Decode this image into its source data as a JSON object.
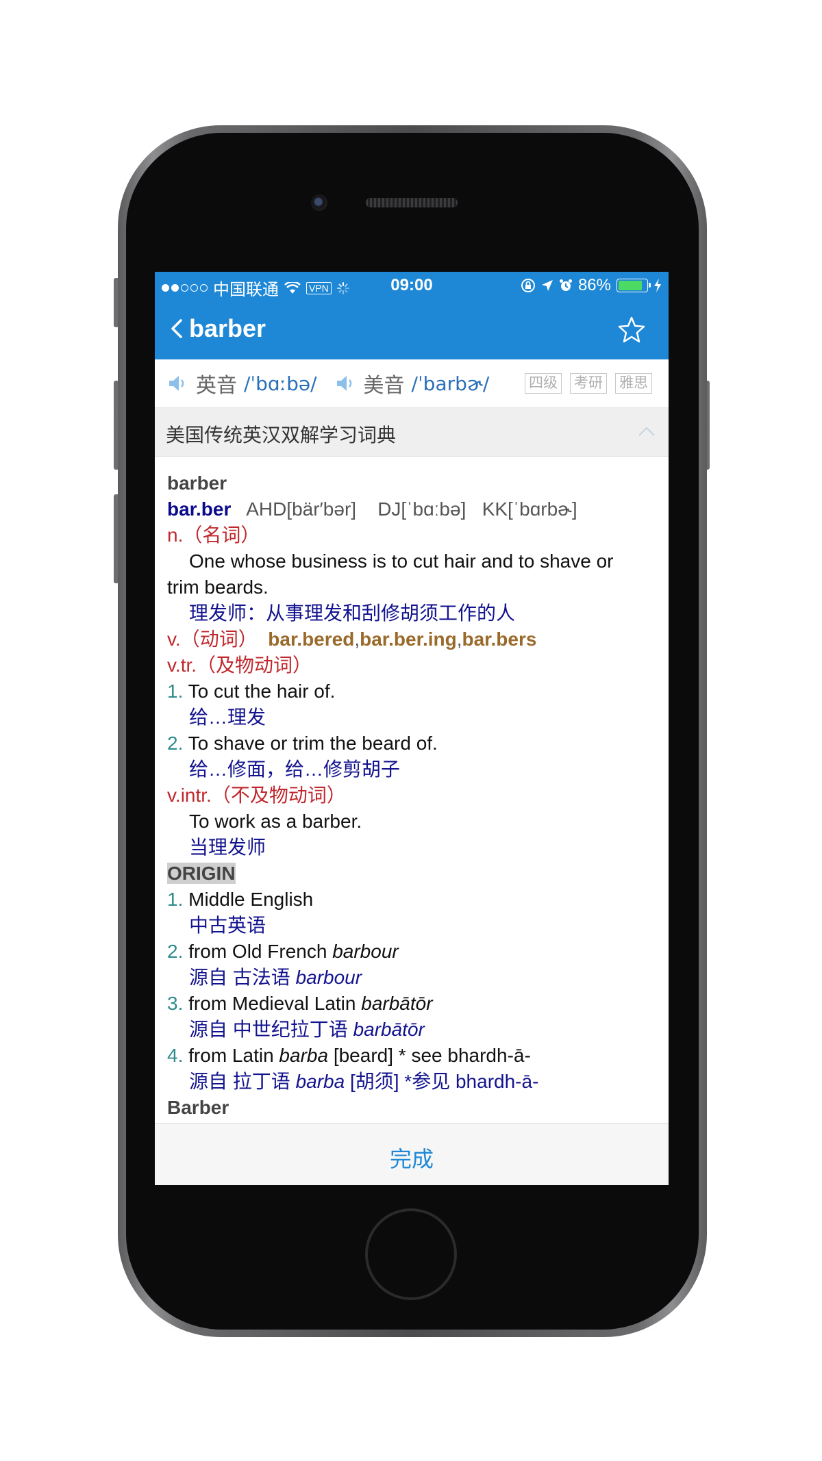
{
  "status": {
    "carrier": "中国联通",
    "vpn": "VPN",
    "time": "09:00",
    "battery": "86%",
    "battery_level": 0.86
  },
  "nav": {
    "title": "barber"
  },
  "pronunciation": {
    "uk_label": "英音",
    "uk_ipa": "/ˈbɑːbə/",
    "us_label": "美音",
    "us_ipa": "/ˈbarbɚ/",
    "tags": [
      "四级",
      "考研",
      "雅思"
    ]
  },
  "dictionary": {
    "name": "美国传统英汉双解学习词典"
  },
  "entry": {
    "headword": "barber",
    "syllabified": "bar.ber",
    "ahd": "AHD[bär′bər]",
    "dj": "DJ[ˈbɑːbə]",
    "kk": "KK[ˈbɑrbɚ]",
    "noun_label": "n.（名词）",
    "noun_def_en": "One whose business is to cut hair and to shave or",
    "noun_def_en2": "trim beards.",
    "noun_def_cn": "理发师：从事理发和刮修胡须工作的人",
    "verb_label": "v.（动词）",
    "verb_forms": [
      "bar.bered",
      "bar.ber.ing",
      "bar.bers"
    ],
    "vtr_label": "v.tr.（及物动词）",
    "vtr_senses": [
      {
        "num": "1.",
        "en": "To cut the hair of.",
        "cn": "给…理发"
      },
      {
        "num": "2.",
        "en": "To shave or trim the beard of.",
        "cn": "给…修面，给…修剪胡子"
      }
    ],
    "vintr_label": "v.intr.（不及物动词）",
    "vintr_en": "To work as a barber.",
    "vintr_cn": "当理发师",
    "origin_label": "ORIGIN",
    "origin": [
      {
        "num": "1.",
        "en": "Middle English",
        "en_it": "",
        "cn": "中古英语",
        "cn_it": ""
      },
      {
        "num": "2.",
        "en": "from Old French ",
        "en_it": "barbour",
        "cn": "源自 古法语 ",
        "cn_it": "barbour"
      },
      {
        "num": "3.",
        "en": "from Medieval Latin ",
        "en_it": "barbātōr",
        "cn": "源自 中世纪拉丁语 ",
        "cn_it": "barbātōr"
      }
    ],
    "origin4": {
      "num": "4.",
      "en_a": "from Latin ",
      "en_it": "barba",
      "en_b": " [beard] * see  bhardh-ā-",
      "cn_a": "源自 拉丁语 ",
      "cn_it": "barba",
      "cn_b": " [胡须] *参见 bhardh-ā-"
    },
    "next_headword": "Barber"
  },
  "footer": {
    "done_label": "完成"
  },
  "colors": {
    "accent": "#1e88d6",
    "pos": "#c0282d",
    "chinese": "#13138f",
    "inflection": "#9a6a2a"
  }
}
